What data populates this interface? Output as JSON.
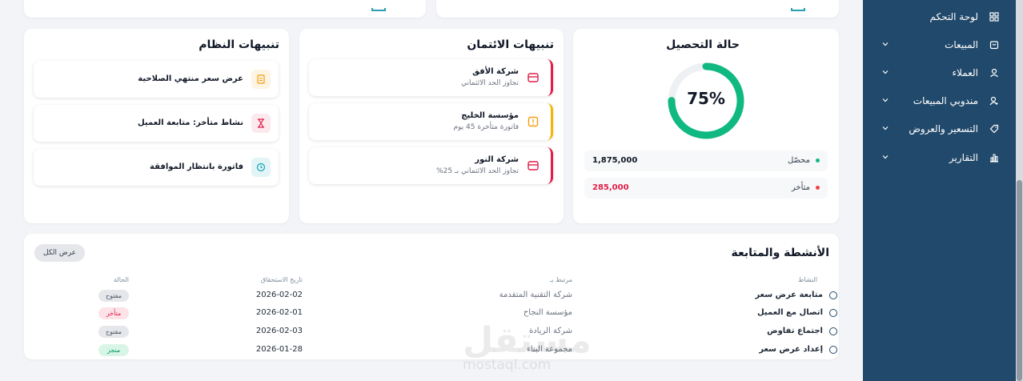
{
  "sidebar": {
    "items": [
      {
        "label": "لوحة التحكم",
        "icon": "grid-icon"
      },
      {
        "label": "المبيعات",
        "icon": "cart-icon"
      },
      {
        "label": "العملاء",
        "icon": "user-icon"
      },
      {
        "label": "مندوبي المبيعات",
        "icon": "user-add-icon"
      },
      {
        "label": "التسعير والعروض",
        "icon": "tag-icon"
      },
      {
        "label": "التقارير",
        "icon": "bar-chart-icon"
      }
    ]
  },
  "collection": {
    "title": "حالة التحصيل",
    "percent_label": "75%",
    "percent": 75,
    "rows": [
      {
        "label": "محصّل",
        "value": "1,875,000",
        "color": "#10b981"
      },
      {
        "label": "متأخر",
        "value": "285,000",
        "color": "#ef4444"
      }
    ]
  },
  "credit_alerts": {
    "title": "تنبيهات الائتمان",
    "items": [
      {
        "title": "شركة الأفق",
        "sub": "تجاوز الحد الائتماني",
        "color": "#e11d48",
        "icon": "card-icon"
      },
      {
        "title": "مؤسسة الخليج",
        "sub": "فاتورة متأخرة 45 يوم",
        "color": "#f59e0b",
        "icon": "warning-icon"
      },
      {
        "title": "شركة النور",
        "sub": "تجاوز الحد الائتماني بـ 25%",
        "color": "#e11d48",
        "icon": "card-icon"
      }
    ]
  },
  "system_alerts": {
    "title": "تنبيهات النظام",
    "items": [
      {
        "title": "عرض سعر منتهي الصلاحية",
        "icon": "document-icon",
        "color": "#f59e0b",
        "bg": "#fdf4e3"
      },
      {
        "title": "نشاط متأخر: متابعة العميل",
        "icon": "hourglass-icon",
        "color": "#e11d48",
        "bg": "#fce9ee"
      },
      {
        "title": "فاتورة بانتظار الموافقة",
        "icon": "clock-icon",
        "color": "#0ea5b7",
        "bg": "#e3f4f7"
      }
    ]
  },
  "activities": {
    "title": "الأنشطة والمتابعة",
    "view_all": "عرض الكل",
    "headers": {
      "activity": "النشاط",
      "related": "مرتبط بـ",
      "due": "تاريخ الاستحقاق",
      "status": "الحالة"
    },
    "rows": [
      {
        "activity": "متابعة عرض سعر",
        "related": "شركة التقنية المتقدمة",
        "due": "2026-02-02",
        "status": "مفتوح",
        "status_color": "#4b5563",
        "status_bg": "#e5e7eb"
      },
      {
        "activity": "اتصال مع العميل",
        "related": "مؤسسة النجاح",
        "due": "2026-02-01",
        "status": "متأخر",
        "status_color": "#e11d48",
        "status_bg": "#fde2e7"
      },
      {
        "activity": "اجتماع تفاوض",
        "related": "شركة الريادة",
        "due": "2026-02-03",
        "status": "مفتوح",
        "status_color": "#4b5563",
        "status_bg": "#e5e7eb"
      },
      {
        "activity": "إعداد عرض سعر",
        "related": "مجموعة البناء",
        "due": "2026-01-28",
        "status": "منجز",
        "status_color": "#059669",
        "status_bg": "#d9f5e8"
      }
    ]
  },
  "watermark": {
    "ar": "مستقل",
    "en": "mostaql.com"
  }
}
